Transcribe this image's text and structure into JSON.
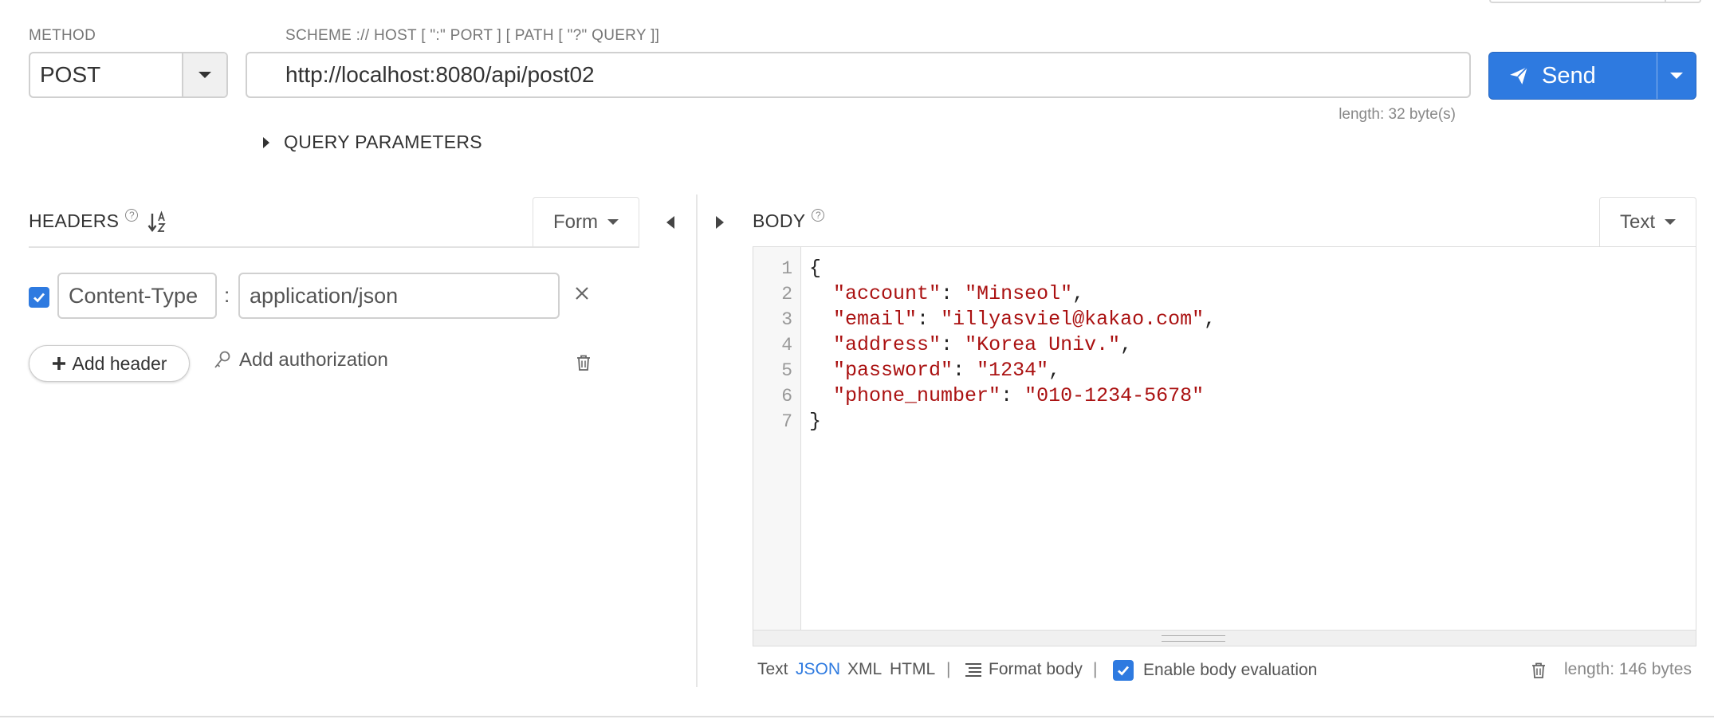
{
  "request": {
    "method_label": "METHOD",
    "method_value": "POST",
    "url_label": "SCHEME :// HOST [ \":\" PORT ] [ PATH [ \"?\" QUERY ]]",
    "url_value": "http://localhost:8080/api/post02",
    "url_length": "length: 32 byte(s)",
    "send_label": "Send",
    "query_params_label": "QUERY PARAMETERS"
  },
  "headers": {
    "title": "HEADERS",
    "help": "?",
    "mode_label": "Form",
    "rows": [
      {
        "enabled": true,
        "name": "Content-Type",
        "separator": ":",
        "value": "application/json"
      }
    ],
    "add_header_label": "Add header",
    "add_auth_label": "Add authorization"
  },
  "body": {
    "title": "BODY",
    "help": "?",
    "mode_label": "Text",
    "lines": [
      {
        "n": "1",
        "text": "{"
      },
      {
        "n": "2",
        "key": "\"account\"",
        "val": "\"Minseol\"",
        "end": ","
      },
      {
        "n": "3",
        "key": "\"email\"",
        "val": "\"illyasviel@kakao.com\"",
        "end": ","
      },
      {
        "n": "4",
        "key": "\"address\"",
        "val": "\"Korea Univ.\"",
        "end": ","
      },
      {
        "n": "5",
        "key": "\"password\"",
        "val": "\"1234\"",
        "end": ","
      },
      {
        "n": "6",
        "key": "\"phone_number\"",
        "val": "\"010-1234-5678\"",
        "end": ""
      },
      {
        "n": "7",
        "text": "}"
      }
    ],
    "format_options": [
      "Text",
      "JSON",
      "XML",
      "HTML"
    ],
    "selected_format": "JSON",
    "separator": "|",
    "format_body_label": "Format body",
    "enable_eval_label": "Enable body evaluation",
    "body_length": "length: 146 bytes"
  },
  "colors": {
    "accent": "#2e7ae0",
    "json_string": "#aa1111"
  }
}
